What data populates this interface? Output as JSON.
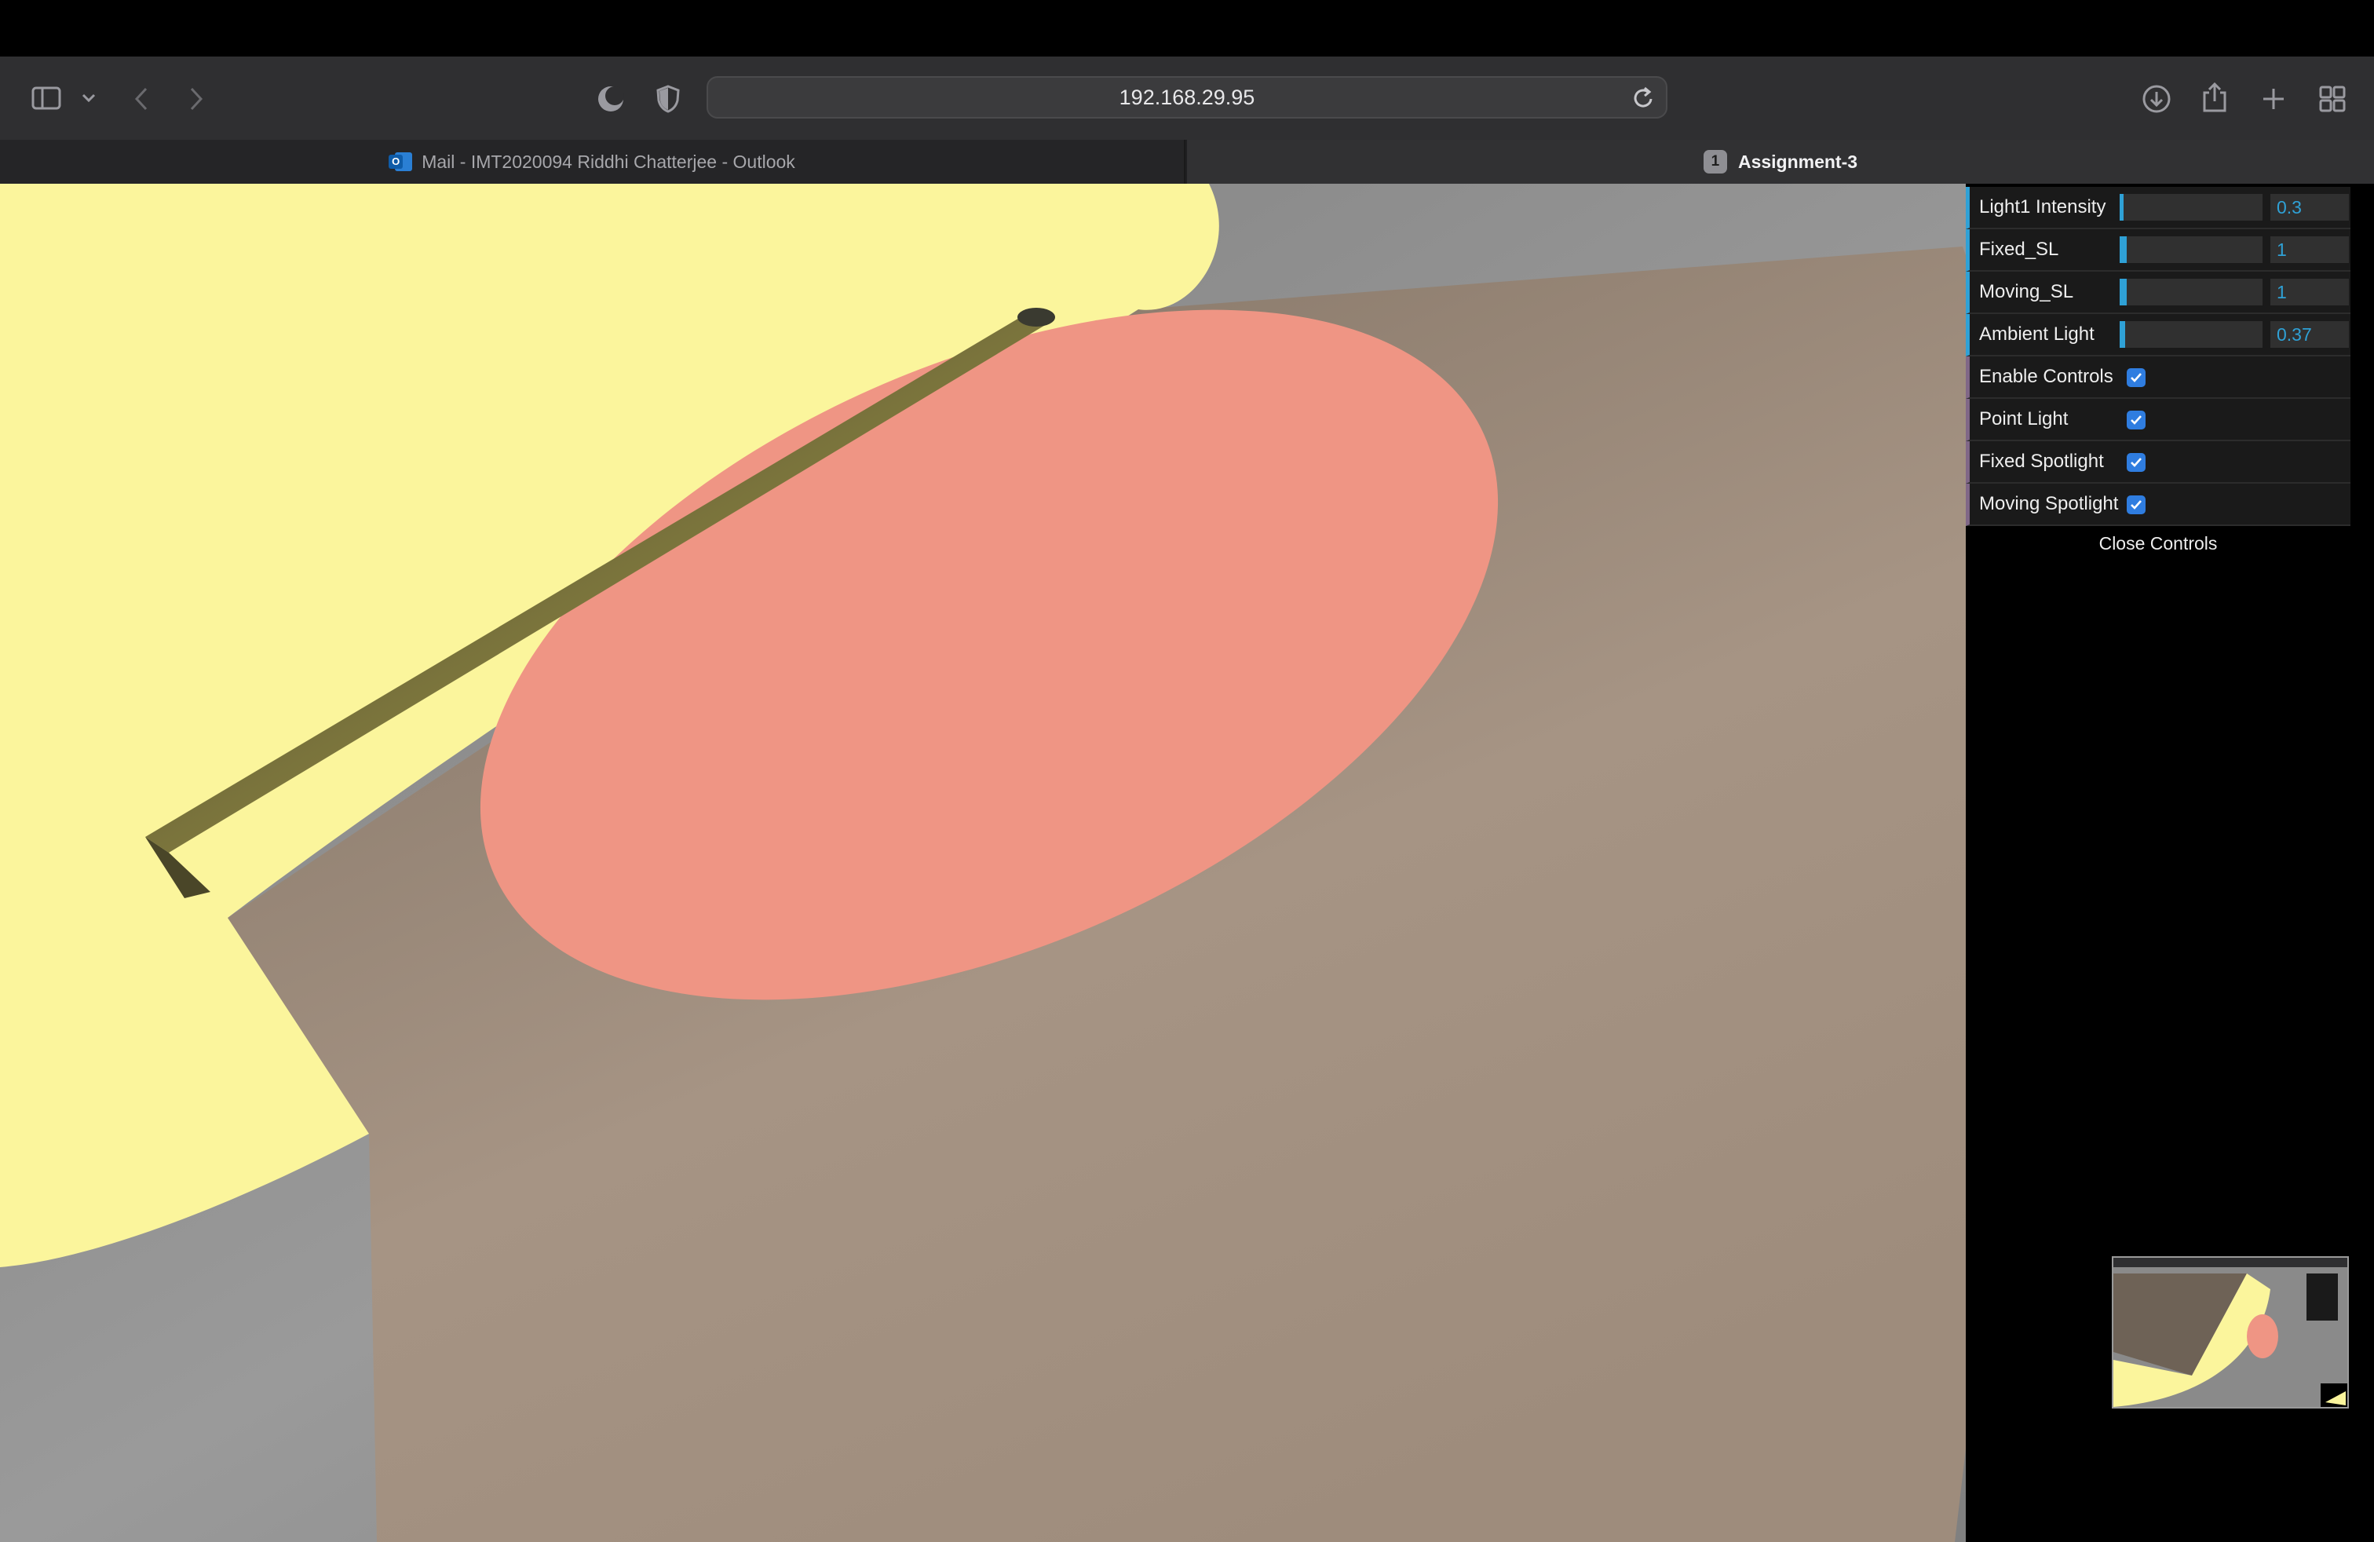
{
  "browser": {
    "url": "192.168.29.95",
    "tabs": [
      {
        "title": "Mail - IMT2020094 Riddhi Chatterjee - Outlook",
        "icon": "outlook-icon",
        "active": false
      },
      {
        "title": "Assignment-3",
        "badge": "1",
        "active": true
      }
    ],
    "toolbar_icons": [
      "sidebar-icon",
      "chevron-down-icon",
      "back-icon",
      "forward-icon",
      "night-mode-icon",
      "privacy-shield-icon",
      "reload-icon",
      "download-icon",
      "share-icon",
      "new-tab-icon",
      "tab-overview-icon"
    ]
  },
  "gui": {
    "sliders": [
      {
        "label": "Light1 Intensity",
        "value": "0.3",
        "fill_fraction": 0.03
      },
      {
        "label": "Fixed_SL",
        "value": "1",
        "fill_fraction": 0.05
      },
      {
        "label": "Moving_SL",
        "value": "1",
        "fill_fraction": 0.05
      },
      {
        "label": "Ambient Light",
        "value": "0.37",
        "fill_fraction": 0.04
      }
    ],
    "checkboxes": [
      {
        "label": "Enable Controls",
        "checked": true
      },
      {
        "label": "Point Light",
        "checked": true
      },
      {
        "label": "Fixed Spotlight",
        "checked": true
      },
      {
        "label": "Moving Spotlight",
        "checked": true
      }
    ],
    "close_label": "Close Controls"
  },
  "colors": {
    "accent": "#2fa1d6",
    "spot_yellow": "#fbf59c",
    "spot_red": "#ef9584",
    "floor_gray": "#8a8a8a",
    "plane_brown": "#a59282"
  }
}
